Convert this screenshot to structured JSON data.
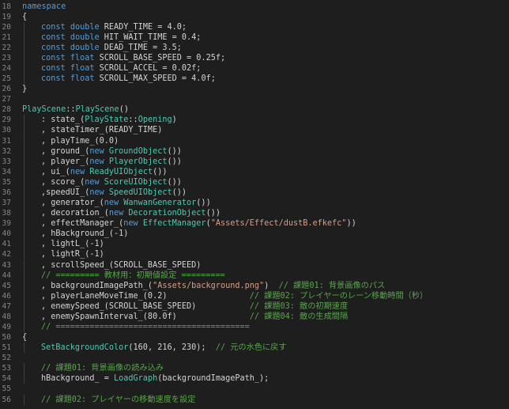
{
  "colors": {
    "background": "#1e1e1e",
    "line_number": "#858585",
    "plain": "#d4d4d4",
    "keyword": "#569cd6",
    "type": "#4ec9b0",
    "comment": "#57a64a",
    "string": "#d69d85",
    "number": "#b5cea8"
  },
  "lines": [
    {
      "n": "18",
      "indent": 0,
      "tokens": [
        [
          "kw",
          "namespace"
        ]
      ]
    },
    {
      "n": "19",
      "indent": 0,
      "tokens": [
        [
          "pl",
          "{"
        ]
      ]
    },
    {
      "n": "20",
      "indent": 1,
      "tokens": [
        [
          "kw",
          "const "
        ],
        [
          "kw",
          "double "
        ],
        [
          "pl",
          "READY_TIME = "
        ],
        [
          "pl",
          "4.0;"
        ]
      ]
    },
    {
      "n": "21",
      "indent": 1,
      "tokens": [
        [
          "kw",
          "const "
        ],
        [
          "kw",
          "double "
        ],
        [
          "pl",
          "HIT_WAIT_TIME = "
        ],
        [
          "pl",
          "0.4;"
        ]
      ]
    },
    {
      "n": "22",
      "indent": 1,
      "tokens": [
        [
          "kw",
          "const "
        ],
        [
          "kw",
          "double "
        ],
        [
          "pl",
          "DEAD_TIME = "
        ],
        [
          "pl",
          "3.5;"
        ]
      ]
    },
    {
      "n": "23",
      "indent": 1,
      "tokens": [
        [
          "kw",
          "const "
        ],
        [
          "kw",
          "float "
        ],
        [
          "pl",
          "SCROLL_BASE_SPEED = "
        ],
        [
          "pl",
          "0.25f;"
        ]
      ]
    },
    {
      "n": "24",
      "indent": 1,
      "tokens": [
        [
          "kw",
          "const "
        ],
        [
          "kw",
          "float "
        ],
        [
          "pl",
          "SCROLL_ACCEL = "
        ],
        [
          "pl",
          "0.02f;"
        ]
      ]
    },
    {
      "n": "25",
      "indent": 1,
      "tokens": [
        [
          "kw",
          "const "
        ],
        [
          "kw",
          "float "
        ],
        [
          "pl",
          "SCROLL_MAX_SPEED = "
        ],
        [
          "pl",
          "4.0f;"
        ]
      ]
    },
    {
      "n": "26",
      "indent": 0,
      "tokens": [
        [
          "pl",
          "}"
        ]
      ]
    },
    {
      "n": "27",
      "indent": 0,
      "tokens": []
    },
    {
      "n": "28",
      "indent": 0,
      "tokens": [
        [
          "ty",
          "PlayScene"
        ],
        [
          "pl",
          "::"
        ],
        [
          "ty",
          "PlayScene"
        ],
        [
          "pl",
          "()"
        ]
      ]
    },
    {
      "n": "29",
      "indent": 1,
      "tokens": [
        [
          "pl",
          ": state_("
        ],
        [
          "ty",
          "PlayState"
        ],
        [
          "pl",
          "::"
        ],
        [
          "ty",
          "Opening"
        ],
        [
          "pl",
          ")"
        ]
      ]
    },
    {
      "n": "30",
      "indent": 1,
      "tokens": [
        [
          "pl",
          ", stateTimer_(READY_TIME)"
        ]
      ]
    },
    {
      "n": "31",
      "indent": 1,
      "tokens": [
        [
          "pl",
          ", playTime_(0.0)"
        ]
      ]
    },
    {
      "n": "32",
      "indent": 1,
      "tokens": [
        [
          "pl",
          ", ground_("
        ],
        [
          "kw",
          "new "
        ],
        [
          "ty",
          "GroundObject"
        ],
        [
          "pl",
          "())"
        ]
      ]
    },
    {
      "n": "33",
      "indent": 1,
      "tokens": [
        [
          "pl",
          ", player_("
        ],
        [
          "kw",
          "new "
        ],
        [
          "ty",
          "PlayerObject"
        ],
        [
          "pl",
          "())"
        ]
      ]
    },
    {
      "n": "34",
      "indent": 1,
      "tokens": [
        [
          "pl",
          ", ui_("
        ],
        [
          "kw",
          "new "
        ],
        [
          "ty",
          "ReadyUIObject"
        ],
        [
          "pl",
          "())"
        ]
      ]
    },
    {
      "n": "35",
      "indent": 1,
      "tokens": [
        [
          "pl",
          ", score_("
        ],
        [
          "kw",
          "new "
        ],
        [
          "ty",
          "ScoreUIObject"
        ],
        [
          "pl",
          "())"
        ]
      ]
    },
    {
      "n": "36",
      "indent": 1,
      "tokens": [
        [
          "pl",
          ",speedUI_("
        ],
        [
          "kw",
          "new "
        ],
        [
          "ty",
          "SpeedUIObject"
        ],
        [
          "pl",
          "())"
        ]
      ]
    },
    {
      "n": "37",
      "indent": 1,
      "tokens": [
        [
          "pl",
          ", generator_("
        ],
        [
          "kw",
          "new "
        ],
        [
          "ty",
          "WanwanGenerator"
        ],
        [
          "pl",
          "())"
        ]
      ]
    },
    {
      "n": "38",
      "indent": 1,
      "tokens": [
        [
          "pl",
          ", decoration_("
        ],
        [
          "kw",
          "new "
        ],
        [
          "ty",
          "DecorationObject"
        ],
        [
          "pl",
          "())"
        ]
      ]
    },
    {
      "n": "39",
      "indent": 1,
      "tokens": [
        [
          "pl",
          ", effectManager_("
        ],
        [
          "kw",
          "new "
        ],
        [
          "ty",
          "EffectManager"
        ],
        [
          "pl",
          "("
        ],
        [
          "st",
          "\"Assets/Effect/dustB.efkefc\""
        ],
        [
          "pl",
          "))"
        ]
      ]
    },
    {
      "n": "40",
      "indent": 1,
      "tokens": [
        [
          "pl",
          ", hBackground_(-1)"
        ]
      ]
    },
    {
      "n": "41",
      "indent": 1,
      "tokens": [
        [
          "pl",
          ", lightL_(-1)"
        ]
      ]
    },
    {
      "n": "42",
      "indent": 1,
      "tokens": [
        [
          "pl",
          ", lightR_(-1)"
        ]
      ]
    },
    {
      "n": "43",
      "indent": 1,
      "tokens": [
        [
          "pl",
          ", scrollSpeed_(SCROLL_BASE_SPEED)"
        ]
      ]
    },
    {
      "n": "44",
      "indent": 1,
      "tokens": [
        [
          "cm",
          "// ========= 教材用：初期値設定 ========="
        ]
      ]
    },
    {
      "n": "45",
      "indent": 1,
      "tokens": [
        [
          "pl",
          ", backgroundImagePath_("
        ],
        [
          "st",
          "\"Assets/background.png\""
        ],
        [
          "pl",
          ")  "
        ],
        [
          "cm",
          "// 課題01: 背景画像のパス"
        ]
      ]
    },
    {
      "n": "46",
      "indent": 1,
      "tokens": [
        [
          "pl",
          ", playerLaneMoveTime_(0.2)                 "
        ],
        [
          "cm",
          "// 課題02: プレイヤーのレーン移動時間（秒）"
        ]
      ]
    },
    {
      "n": "47",
      "indent": 1,
      "tokens": [
        [
          "pl",
          ", enemySpeed_(SCROLL_BASE_SPEED)           "
        ],
        [
          "cm",
          "// 課題03: 敵の初期速度"
        ]
      ]
    },
    {
      "n": "48",
      "indent": 1,
      "tokens": [
        [
          "pl",
          ", enemySpawnInterval_(80.0f)               "
        ],
        [
          "cm",
          "// 課題04: 敵の生成間隔"
        ]
      ]
    },
    {
      "n": "49",
      "indent": 1,
      "tokens": [
        [
          "cm",
          "// ========================================"
        ]
      ]
    },
    {
      "n": "50",
      "indent": 0,
      "tokens": [
        [
          "pl",
          "{"
        ]
      ]
    },
    {
      "n": "51",
      "indent": 1,
      "tokens": [
        [
          "ty",
          "SetBackgroundColor"
        ],
        [
          "pl",
          "(160, 216, 230);  "
        ],
        [
          "cm",
          "// 元の水色に戻す"
        ]
      ]
    },
    {
      "n": "52",
      "indent": 0,
      "tokens": []
    },
    {
      "n": "53",
      "indent": 1,
      "tokens": [
        [
          "cm",
          "// 課題01: 背景画像の読み込み"
        ]
      ]
    },
    {
      "n": "54",
      "indent": 1,
      "tokens": [
        [
          "pl",
          "hBackground_ = "
        ],
        [
          "ty",
          "LoadGraph"
        ],
        [
          "pl",
          "(backgroundImagePath_);"
        ]
      ]
    },
    {
      "n": "55",
      "indent": 0,
      "tokens": []
    },
    {
      "n": "56",
      "indent": 1,
      "tokens": [
        [
          "cm",
          "// 課題02: プレイヤーの移動速度を設定"
        ]
      ]
    }
  ]
}
